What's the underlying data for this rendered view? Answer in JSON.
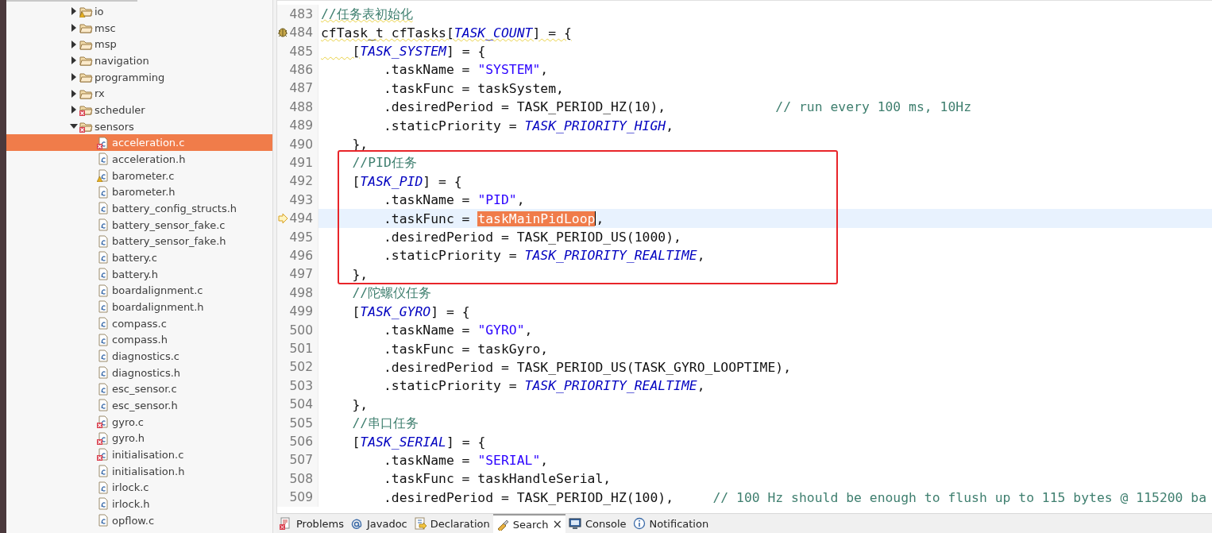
{
  "project_tree": [
    {
      "label": "io",
      "kind": "folder",
      "expanded": false,
      "selected": false,
      "has_warning": true
    },
    {
      "label": "msc",
      "kind": "folder",
      "expanded": false,
      "selected": false
    },
    {
      "label": "msp",
      "kind": "folder",
      "expanded": false,
      "selected": false
    },
    {
      "label": "navigation",
      "kind": "folder",
      "expanded": false,
      "selected": false
    },
    {
      "label": "programming",
      "kind": "folder",
      "expanded": false,
      "selected": false
    },
    {
      "label": "rx",
      "kind": "folder",
      "expanded": false,
      "selected": false
    },
    {
      "label": "scheduler",
      "kind": "folder",
      "expanded": false,
      "selected": false,
      "has_error": true
    },
    {
      "label": "sensors",
      "kind": "folder",
      "expanded": true,
      "selected": false,
      "has_error": true,
      "children": [
        {
          "label": "acceleration.c",
          "kind": "file",
          "selected": true,
          "has_error": true
        },
        {
          "label": "acceleration.h",
          "kind": "file",
          "selected": false
        },
        {
          "label": "barometer.c",
          "kind": "file",
          "selected": false,
          "has_warning": true
        },
        {
          "label": "barometer.h",
          "kind": "file",
          "selected": false
        },
        {
          "label": "battery_config_structs.h",
          "kind": "file",
          "selected": false
        },
        {
          "label": "battery_sensor_fake.c",
          "kind": "file",
          "selected": false
        },
        {
          "label": "battery_sensor_fake.h",
          "kind": "file",
          "selected": false
        },
        {
          "label": "battery.c",
          "kind": "file",
          "selected": false
        },
        {
          "label": "battery.h",
          "kind": "file",
          "selected": false
        },
        {
          "label": "boardalignment.c",
          "kind": "file",
          "selected": false
        },
        {
          "label": "boardalignment.h",
          "kind": "file",
          "selected": false
        },
        {
          "label": "compass.c",
          "kind": "file",
          "selected": false
        },
        {
          "label": "compass.h",
          "kind": "file",
          "selected": false
        },
        {
          "label": "diagnostics.c",
          "kind": "file",
          "selected": false
        },
        {
          "label": "diagnostics.h",
          "kind": "file",
          "selected": false
        },
        {
          "label": "esc_sensor.c",
          "kind": "file",
          "selected": false
        },
        {
          "label": "esc_sensor.h",
          "kind": "file",
          "selected": false
        },
        {
          "label": "gyro.c",
          "kind": "file",
          "selected": false,
          "has_error": true
        },
        {
          "label": "gyro.h",
          "kind": "file",
          "selected": false,
          "has_error": true
        },
        {
          "label": "initialisation.c",
          "kind": "file",
          "selected": false,
          "has_error": true
        },
        {
          "label": "initialisation.h",
          "kind": "file",
          "selected": false
        },
        {
          "label": "irlock.c",
          "kind": "file",
          "selected": false
        },
        {
          "label": "irlock.h",
          "kind": "file",
          "selected": false
        },
        {
          "label": "opflow.c",
          "kind": "file",
          "selected": false
        }
      ]
    }
  ],
  "editor": {
    "blocks": [
      {
        "boxed": false,
        "lines": [
          {
            "number": "483",
            "tokens": [
              {
                "kind": "comment",
                "text": "//任务表初始化",
                "warning": true
              }
            ]
          },
          {
            "number": "484",
            "has_warning": true,
            "tokens": [
              {
                "kind": "plain",
                "text": "cfTask_t cfTasks[",
                "warning": true
              },
              {
                "kind": "macro",
                "text": "TASK_COUNT",
                "warning": true
              },
              {
                "kind": "plain",
                "text": "] = {",
                "warning": true
              }
            ]
          },
          {
            "number": "485",
            "tokens": [
              {
                "kind": "plain",
                "text": "    [",
                "warning": true
              },
              {
                "kind": "macro",
                "text": "TASK_SYSTEM"
              },
              {
                "kind": "plain",
                "text": "] = {"
              }
            ]
          },
          {
            "number": "486",
            "tokens": [
              {
                "kind": "plain",
                "text": "        .taskName = "
              },
              {
                "kind": "string",
                "text": "\"SYSTEM\""
              },
              {
                "kind": "plain",
                "text": ","
              }
            ]
          },
          {
            "number": "487",
            "tokens": [
              {
                "kind": "plain",
                "text": "        .taskFunc = taskSystem,"
              }
            ]
          },
          {
            "number": "488",
            "tokens": [
              {
                "kind": "plain",
                "text": "        .desiredPeriod = TASK_PERIOD_HZ(10),              "
              },
              {
                "kind": "comment",
                "text": "// run every 100 ms, 10Hz"
              }
            ]
          },
          {
            "number": "489",
            "tokens": [
              {
                "kind": "plain",
                "text": "        .staticPriority = "
              },
              {
                "kind": "macro",
                "text": "TASK_PRIORITY_HIGH"
              },
              {
                "kind": "plain",
                "text": ","
              }
            ]
          },
          {
            "number": "490",
            "tokens": [
              {
                "kind": "plain",
                "text": "    },"
              }
            ]
          }
        ]
      },
      {
        "boxed": true,
        "lines": [
          {
            "number": "491",
            "tokens": [
              {
                "kind": "comment",
                "text": "    //PID任务"
              }
            ]
          },
          {
            "number": "492",
            "tokens": [
              {
                "kind": "plain",
                "text": "    ["
              },
              {
                "kind": "macro",
                "text": "TASK_PID"
              },
              {
                "kind": "plain",
                "text": "] = {"
              }
            ]
          },
          {
            "number": "493",
            "tokens": [
              {
                "kind": "plain",
                "text": "        .taskName = "
              },
              {
                "kind": "string",
                "text": "\"PID\""
              },
              {
                "kind": "plain",
                "text": ","
              }
            ]
          },
          {
            "number": "494",
            "current": true,
            "instruction_pointer": true,
            "tokens": [
              {
                "kind": "plain",
                "text": "        .taskFunc = "
              },
              {
                "kind": "selection",
                "text": "taskMainPidLoop"
              },
              {
                "kind": "plain",
                "text": ","
              }
            ]
          },
          {
            "number": "495",
            "tokens": [
              {
                "kind": "plain",
                "text": "        .desiredPeriod = TASK_PERIOD_US(1000),"
              }
            ]
          },
          {
            "number": "496",
            "tokens": [
              {
                "kind": "plain",
                "text": "        .staticPriority = "
              },
              {
                "kind": "macro",
                "text": "TASK_PRIORITY_REALTIME"
              },
              {
                "kind": "plain",
                "text": ","
              }
            ]
          },
          {
            "number": "497",
            "tokens": [
              {
                "kind": "plain",
                "text": "    },"
              }
            ]
          }
        ]
      },
      {
        "boxed": false,
        "lines": [
          {
            "number": "498",
            "tokens": [
              {
                "kind": "comment",
                "text": "    //陀螺仪任务"
              }
            ]
          },
          {
            "number": "499",
            "tokens": [
              {
                "kind": "plain",
                "text": "    ["
              },
              {
                "kind": "macro",
                "text": "TASK_GYRO"
              },
              {
                "kind": "plain",
                "text": "] = {"
              }
            ]
          },
          {
            "number": "500",
            "tokens": [
              {
                "kind": "plain",
                "text": "        .taskName = "
              },
              {
                "kind": "string",
                "text": "\"GYRO\""
              },
              {
                "kind": "plain",
                "text": ","
              }
            ]
          },
          {
            "number": "501",
            "tokens": [
              {
                "kind": "plain",
                "text": "        .taskFunc = taskGyro,"
              }
            ]
          },
          {
            "number": "502",
            "tokens": [
              {
                "kind": "plain",
                "text": "        .desiredPeriod = TASK_PERIOD_US(TASK_GYRO_LOOPTIME),"
              }
            ]
          },
          {
            "number": "503",
            "tokens": [
              {
                "kind": "plain",
                "text": "        .staticPriority = "
              },
              {
                "kind": "macro",
                "text": "TASK_PRIORITY_REALTIME"
              },
              {
                "kind": "plain",
                "text": ","
              }
            ]
          },
          {
            "number": "504",
            "tokens": [
              {
                "kind": "plain",
                "text": "    },"
              }
            ]
          },
          {
            "number": "505",
            "tokens": [
              {
                "kind": "comment",
                "text": "    //串口任务"
              }
            ]
          },
          {
            "number": "506",
            "tokens": [
              {
                "kind": "plain",
                "text": "    ["
              },
              {
                "kind": "macro",
                "text": "TASK_SERIAL"
              },
              {
                "kind": "plain",
                "text": "] = {"
              }
            ]
          },
          {
            "number": "507",
            "tokens": [
              {
                "kind": "plain",
                "text": "        .taskName = "
              },
              {
                "kind": "string",
                "text": "\"SERIAL\""
              },
              {
                "kind": "plain",
                "text": ","
              }
            ]
          },
          {
            "number": "508",
            "tokens": [
              {
                "kind": "plain",
                "text": "        .taskFunc = taskHandleSerial,"
              }
            ]
          },
          {
            "number": "509",
            "tokens": [
              {
                "kind": "plain",
                "text": "        .desiredPeriod = TASK_PERIOD_HZ(100),     "
              },
              {
                "kind": "comment",
                "text": "// 100 Hz should be enough to flush up to 115 bytes @ 115200 ba"
              }
            ]
          }
        ]
      }
    ]
  },
  "bottom_tabs": [
    {
      "label": "Problems",
      "selected": false
    },
    {
      "label": "Javadoc",
      "selected": false
    },
    {
      "label": "Declaration",
      "selected": false
    },
    {
      "label": "Search",
      "selected": true,
      "close": "×"
    },
    {
      "label": "Console",
      "selected": false
    },
    {
      "label": "Notification",
      "selected": false
    }
  ]
}
